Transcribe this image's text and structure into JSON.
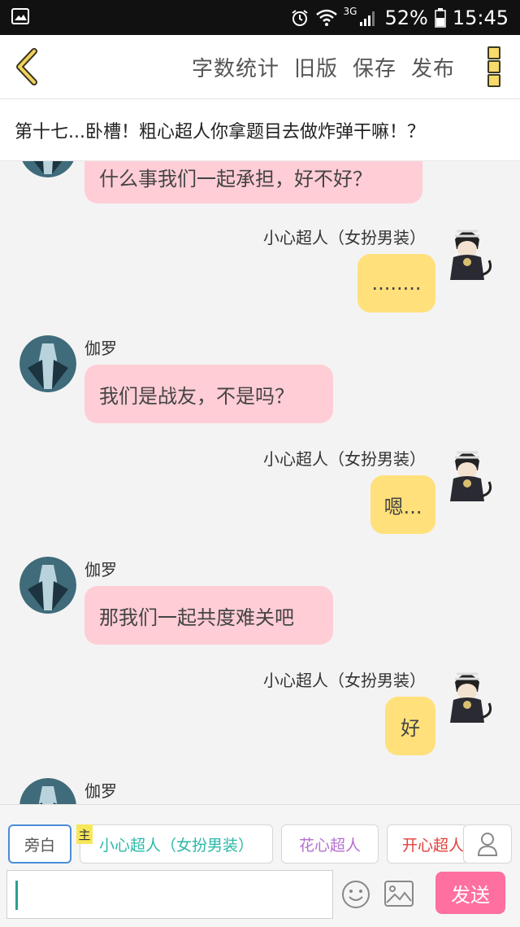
{
  "status_bar": {
    "network": "3G",
    "battery": "52%",
    "time": "15:45"
  },
  "header": {
    "actions": [
      "字数统计",
      "旧版",
      "保存",
      "发布"
    ]
  },
  "chapter_title": "第十七...卧槽！粗心超人你拿题目去做炸弹干嘛！？",
  "messages": [
    {
      "speaker": "",
      "text": "什么事我们一起承担，好不好？",
      "side": "left"
    },
    {
      "speaker": "小心超人（女扮男装）",
      "text": "........",
      "side": "right"
    },
    {
      "speaker": "伽罗",
      "text": "我们是战友，不是吗？",
      "side": "left"
    },
    {
      "speaker": "小心超人（女扮男装）",
      "text": "嗯...",
      "side": "right"
    },
    {
      "speaker": "伽罗",
      "text": "那我们一起共度难关吧",
      "side": "left"
    },
    {
      "speaker": "小心超人（女扮男装）",
      "text": "好",
      "side": "right"
    },
    {
      "speaker": "伽罗",
      "text": "",
      "side": "left"
    }
  ],
  "roles": {
    "narrator": "旁白",
    "main_tag": "主",
    "items": [
      "小心超人（女扮男装）",
      "花心超人",
      "开心超人"
    ]
  },
  "composer": {
    "input_value": "",
    "send_label": "发送"
  },
  "colors": {
    "pink_bubble": "#ffcdd6",
    "yellow_bubble": "#ffe07a",
    "send_button": "#ff6fa0",
    "narrator_border": "#4a8ed6"
  }
}
